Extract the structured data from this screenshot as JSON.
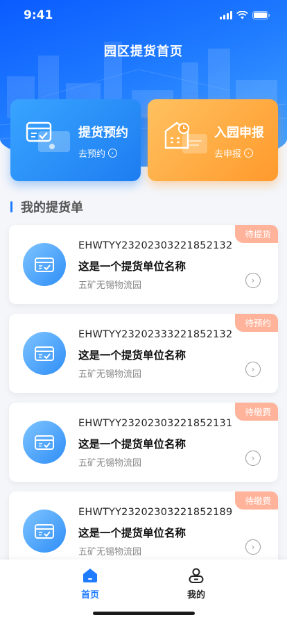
{
  "status_bar": {
    "time": "9:41"
  },
  "header": {
    "title": "园区提货首页"
  },
  "actions": [
    {
      "title": "提货预约",
      "subtitle": "去预约",
      "color": "#1f87f5"
    },
    {
      "title": "入园申报",
      "subtitle": "去申报",
      "color": "#ffa63a"
    }
  ],
  "section": {
    "title": "我的提货单",
    "accent": "#1f7bff"
  },
  "orders": [
    {
      "code": "EHWTYY23202303221852132",
      "name": "这是一个提货单位名称",
      "place": "五矿无锡物流园",
      "status": "待提货"
    },
    {
      "code": "EHWTYY23202333221852132",
      "name": "这是一个提货单位名称",
      "place": "五矿无锡物流园",
      "status": "待预约"
    },
    {
      "code": "EHWTYY23202303221852131",
      "name": "这是一个提货单位名称",
      "place": "五矿无锡物流园",
      "status": "待缴费"
    },
    {
      "code": "EHWTYY23202303221852189",
      "name": "这是一个提货单位名称",
      "place": "五矿无锡物流园",
      "status": "待缴费"
    }
  ],
  "tabbar": {
    "items": [
      {
        "label": "首页",
        "icon": "home-icon",
        "active": true
      },
      {
        "label": "我的",
        "icon": "user-icon",
        "active": false
      }
    ],
    "active_color": "#1f7bff"
  }
}
